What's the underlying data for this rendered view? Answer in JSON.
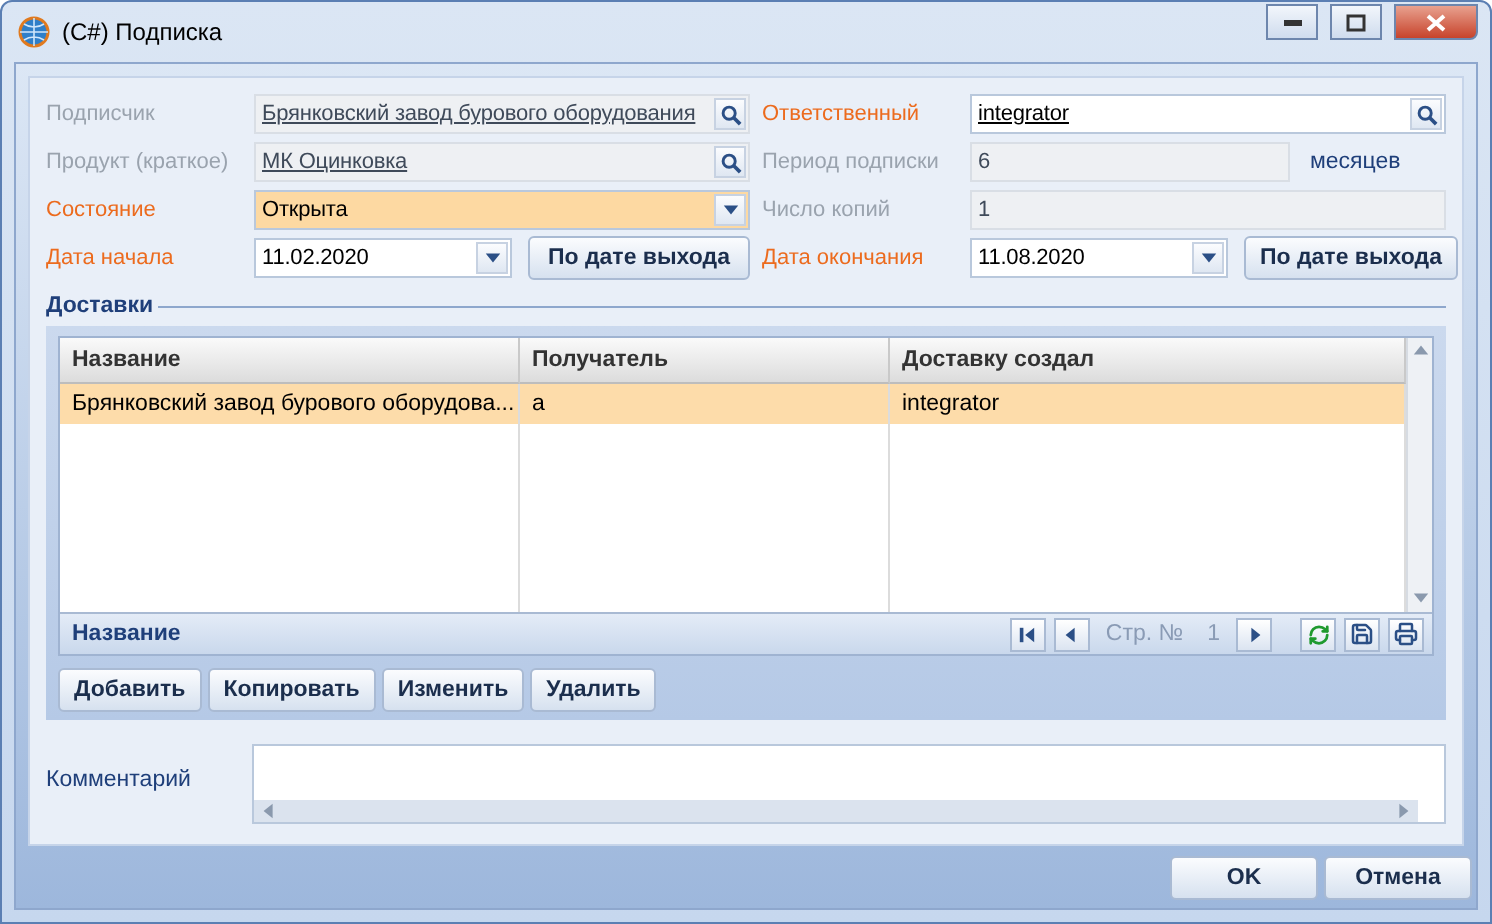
{
  "window": {
    "title": "(C#) Подписка"
  },
  "form_rows": [
    {
      "left": {
        "label": "Подписчик",
        "required": false,
        "kind": "lookup",
        "value": "Брянковский завод бурового оборудования",
        "disabled": true
      },
      "right": {
        "label": "Ответственный",
        "required": true,
        "kind": "lookup",
        "value": "integrator",
        "disabled": false
      }
    },
    {
      "left": {
        "label": "Продукт (краткое)",
        "required": false,
        "kind": "lookup",
        "value": "МК Оцинковка",
        "disabled": true
      },
      "right": {
        "label": "Период подписки",
        "required": false,
        "kind": "text",
        "value": "6",
        "disabled": true,
        "suffix": "месяцев"
      }
    },
    {
      "left": {
        "label": "Состояние",
        "required": true,
        "kind": "combo",
        "value": "Открыта",
        "disabled": false,
        "highlighted": true
      },
      "right": {
        "label": "Число копий",
        "required": false,
        "kind": "text",
        "value": "1",
        "disabled": true
      }
    },
    {
      "left": {
        "label": "Дата начала",
        "required": true,
        "kind": "date",
        "value": "11.02.2020",
        "disabled": false,
        "button": "По дате выхода"
      },
      "right": {
        "label": "Дата окончания",
        "required": true,
        "kind": "date",
        "value": "11.08.2020",
        "disabled": false,
        "button": "По дате выхода"
      }
    }
  ],
  "deliveries": {
    "title": "Доставки",
    "columns": [
      "Название",
      "Получатель",
      "Доставку создал"
    ],
    "rows": [
      {
        "cells": [
          "Брянковский завод бурового оборудова...",
          "a",
          "integrator"
        ],
        "selected": true
      }
    ],
    "footer_label": "Название",
    "page_label": "Стр. №",
    "page": "1",
    "buttons": [
      "Добавить",
      "Копировать",
      "Изменить",
      "Удалить"
    ]
  },
  "comment": {
    "label": "Комментарий"
  },
  "dialog_buttons": [
    "OK",
    "Отмена"
  ]
}
